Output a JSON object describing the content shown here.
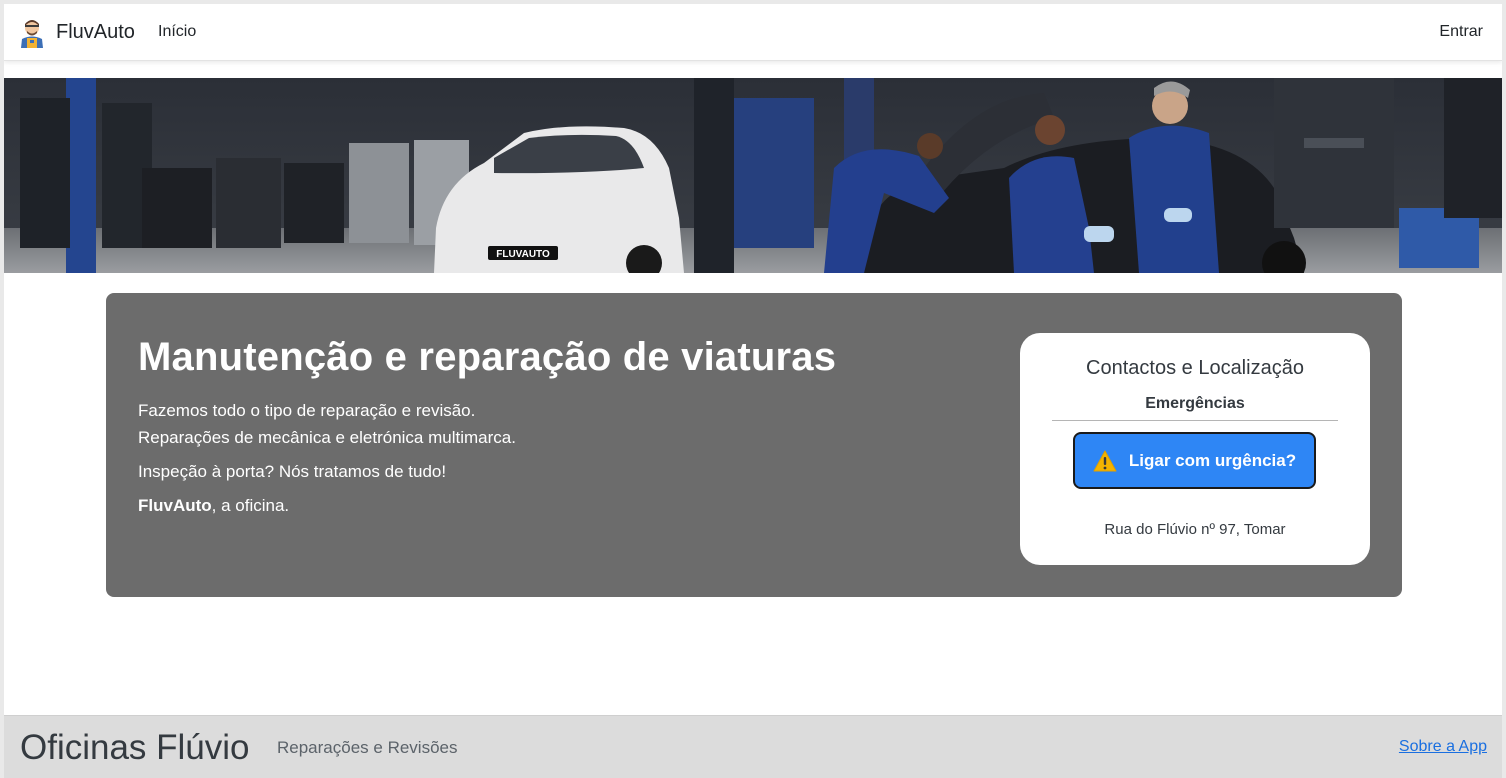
{
  "navbar": {
    "brand": "FluvAuto",
    "logo_icon": "mechanic-avatar-icon",
    "home_label": "Início",
    "login_label": "Entrar"
  },
  "banner": {
    "image_icon": "workshop-banner-image",
    "plate_text": "FLUVAUTO"
  },
  "hero": {
    "title": "Manutenção e reparação de viaturas",
    "line1": "Fazemos todo o tipo de reparação e revisão.",
    "line2": "Reparações de mecânica e eletrónica multimarca.",
    "line3": "Inspeção à porta? Nós tratamos de tudo!",
    "line4_brand": "FluvAuto",
    "line4_rest": ", a oficina."
  },
  "contact": {
    "title": "Contactos e Localização",
    "emergency_label": "Emergências",
    "urgent_button_label": "Ligar com urgência?",
    "warning_icon": "warning-icon",
    "address": "Rua do Flúvio nº 97, Tomar"
  },
  "footer": {
    "title": "Oficinas Flúvio",
    "subtitle": "Reparações e Revisões",
    "about_link": "Sobre a App"
  },
  "colors": {
    "hero_bg": "#6c6c6c",
    "urgent_button": "#2e86f5",
    "footer_bg": "#dcdcdc",
    "link": "#1a6fe0"
  }
}
